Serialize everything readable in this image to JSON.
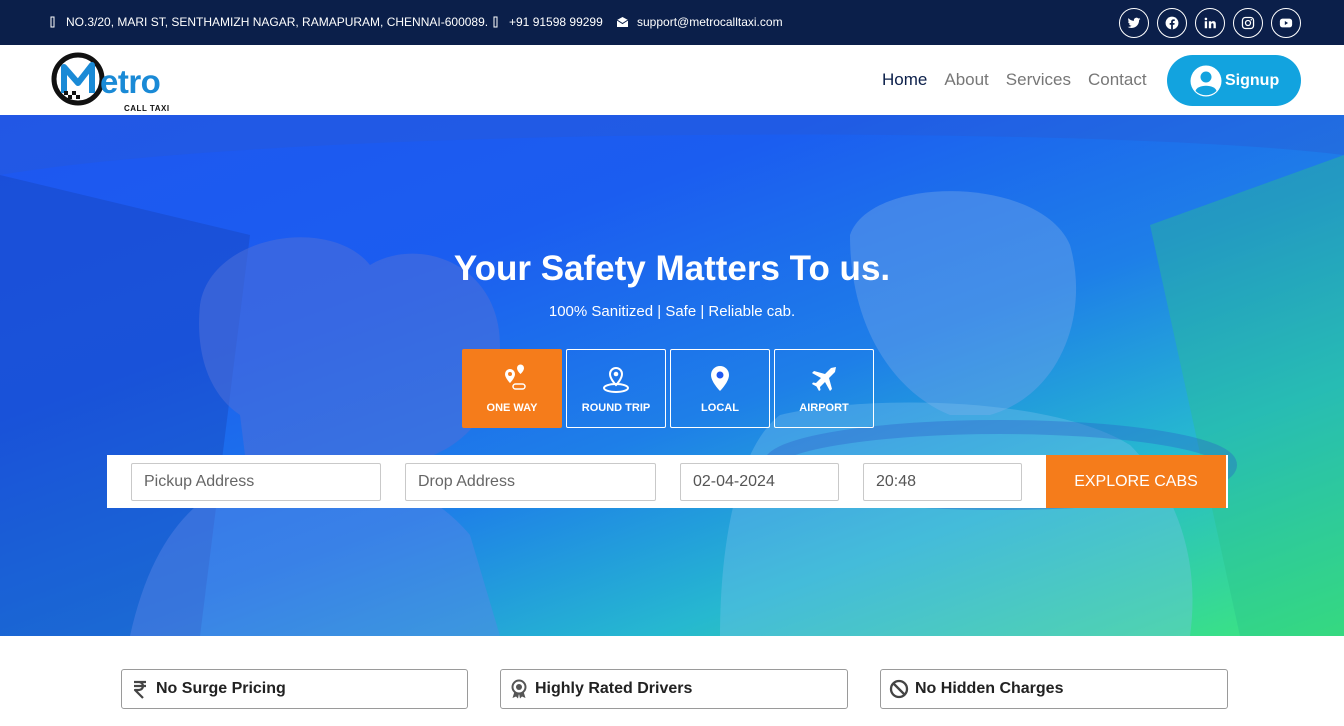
{
  "topbar": {
    "address": "NO.3/20, MARI ST, SENTHAMIZH NAGAR, RAMAPURAM, CHENNAI-600089.",
    "phone": "+91 91598 99299",
    "email": "support@metrocalltaxi.com",
    "social": [
      "twitter-icon",
      "facebook-icon",
      "linkedin-icon",
      "instagram-icon",
      "youtube-icon"
    ]
  },
  "nav": {
    "logo_text": "etro",
    "logo_sub": "CALL TAXI",
    "menu": [
      "Home",
      "About",
      "Services",
      "Contact"
    ],
    "active": "Home",
    "signup": "Signup"
  },
  "hero": {
    "title": "Your Safety Matters To us.",
    "subtitle": "100% Sanitized | Safe | Reliable cab.",
    "tabs": [
      "ONE WAY",
      "ROUND TRIP",
      "LOCAL",
      "AIRPORT"
    ],
    "selected_tab": "ONE WAY",
    "pickup_placeholder": "Pickup Address",
    "drop_placeholder": "Drop Address",
    "date": "02-04-2024",
    "time": "20:48",
    "explore": "EXPLORE CABS"
  },
  "features": [
    "No Surge Pricing",
    "Highly Rated Drivers",
    "No Hidden Charges"
  ],
  "colors": {
    "accent": "#f57c1b",
    "brand": "#12a3df",
    "dark": "#0b1f4a"
  }
}
